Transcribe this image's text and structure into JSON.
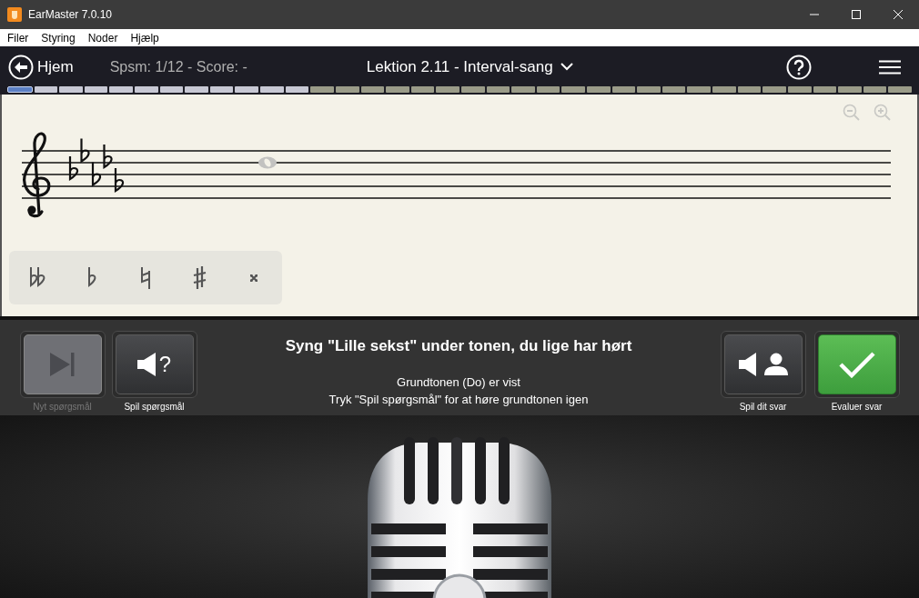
{
  "window": {
    "title": "EarMaster 7.0.10"
  },
  "menu": [
    "Filer",
    "Styring",
    "Noder",
    "Hjælp"
  ],
  "header": {
    "back_label": "Hjem",
    "score": "Spsm: 1/12 - Score: -",
    "lesson_title": "Lektion 2.11 - Interval-sang"
  },
  "progress": [
    {
      "kind": "current"
    },
    {
      "kind": "question"
    },
    {
      "kind": "question"
    },
    {
      "kind": "question"
    },
    {
      "kind": "question"
    },
    {
      "kind": "question"
    },
    {
      "kind": "question"
    },
    {
      "kind": "question"
    },
    {
      "kind": "question"
    },
    {
      "kind": "question"
    },
    {
      "kind": "question"
    },
    {
      "kind": "question"
    },
    {
      "kind": "lesson"
    },
    {
      "kind": "lesson"
    },
    {
      "kind": "lesson"
    },
    {
      "kind": "lesson"
    },
    {
      "kind": "lesson"
    },
    {
      "kind": "lesson"
    },
    {
      "kind": "lesson"
    },
    {
      "kind": "lesson"
    },
    {
      "kind": "lesson"
    },
    {
      "kind": "lesson"
    },
    {
      "kind": "lesson"
    },
    {
      "kind": "lesson"
    },
    {
      "kind": "lesson"
    },
    {
      "kind": "lesson"
    },
    {
      "kind": "lesson"
    },
    {
      "kind": "lesson"
    },
    {
      "kind": "lesson"
    },
    {
      "kind": "lesson"
    },
    {
      "kind": "lesson"
    },
    {
      "kind": "lesson"
    },
    {
      "kind": "lesson"
    },
    {
      "kind": "lesson"
    },
    {
      "kind": "lesson"
    },
    {
      "kind": "lesson"
    }
  ],
  "zoom_controls": {
    "disabled": true
  },
  "staff": {
    "clef": {
      "kind": "treble"
    },
    "key_signature": [
      {
        "kind": "flat"
      },
      {
        "kind": "flat"
      },
      {
        "kind": "flat"
      },
      {
        "kind": "flat"
      },
      {
        "kind": "flat"
      }
    ],
    "notes": [
      {
        "kind": "whole",
        "dimmed": true
      }
    ]
  },
  "accidentals": [
    {
      "kind": "double-flat"
    },
    {
      "kind": "flat"
    },
    {
      "kind": "natural"
    },
    {
      "kind": "sharp"
    },
    {
      "kind": "double-sharp"
    }
  ],
  "left_buttons": [
    {
      "kind": "next",
      "label": "Nyt spørgsmål",
      "disabled": true
    },
    {
      "kind": "play-question",
      "label": "Spil spørgsmål",
      "glyph": "?",
      "disabled": false
    }
  ],
  "instruction": {
    "heading": "Syng \"Lille sekst\" under tonen, du lige har hørt",
    "lines": [
      "Grundtonen (Do) er vist",
      "Tryk \"Spil spørgsmål\" for at høre grundtonen igen"
    ]
  },
  "right_buttons": [
    {
      "kind": "play-answer",
      "label": "Spil dit svar",
      "disabled": false
    },
    {
      "kind": "evaluate",
      "label": "Evaluer svar",
      "disabled": false
    }
  ]
}
